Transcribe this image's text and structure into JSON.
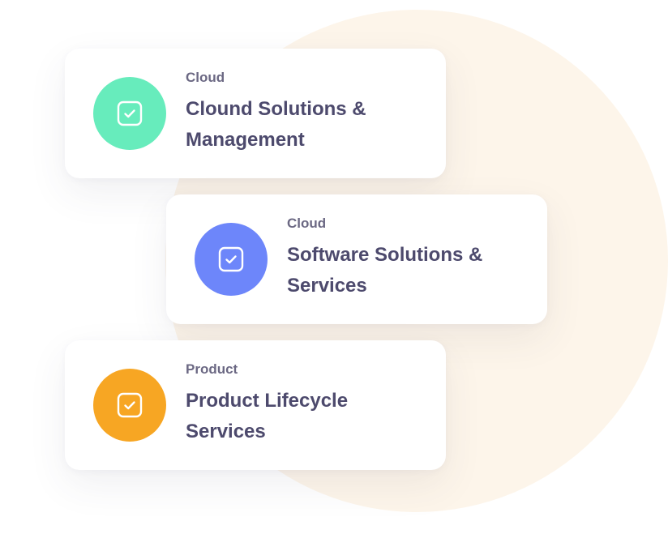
{
  "colors": {
    "background_circle": "#fdf5ea",
    "card_background": "#ffffff",
    "category_text": "#6b6883",
    "title_text": "#4d4a6d"
  },
  "cards": [
    {
      "category": "Cloud",
      "title": "Clound Solutions & Management",
      "icon": "check-square-icon",
      "badge_color": "#67ecbc"
    },
    {
      "category": "Cloud",
      "title": "Software Solutions & Services",
      "icon": "check-square-icon",
      "badge_color": "#6d86fa"
    },
    {
      "category": "Product",
      "title": "Product Lifecycle Services",
      "icon": "check-square-icon",
      "badge_color": "#f7a623"
    }
  ]
}
